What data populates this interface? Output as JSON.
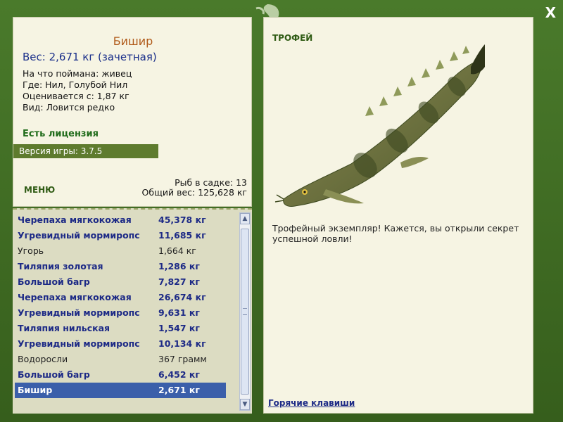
{
  "close_label": "X",
  "fish": {
    "name": "Бишир",
    "weight": "Вес: 2,671 кг (зачетная)",
    "caught_on": "На что поймана: живец",
    "location": "Где: Нил, Голубой Нил",
    "valued_from": "Оценивается с: 1,87 кг",
    "type": "Вид: Ловится редко"
  },
  "license": "Есть лицензия",
  "version": "Версия игры: 3.7.5",
  "menu_label": "МЕНЮ",
  "summary": {
    "fish_count": "Рыб в садке: 13",
    "total_weight": "Общий вес: 125,628 кг"
  },
  "catch_list": [
    {
      "name": "Черепаха мягкокожая",
      "weight": "45,378 кг",
      "style": "bold"
    },
    {
      "name": "Угревидный мормиропс",
      "weight": "11,685 кг",
      "style": "bold"
    },
    {
      "name": "Угорь",
      "weight": "1,664 кг",
      "style": "plain"
    },
    {
      "name": "Тиляпия золотая",
      "weight": "1,286 кг",
      "style": "bold"
    },
    {
      "name": "Большой багр",
      "weight": "7,827 кг",
      "style": "bold"
    },
    {
      "name": "Черепаха мягкокожая",
      "weight": "26,674 кг",
      "style": "bold"
    },
    {
      "name": "Угревидный мормиропс",
      "weight": "9,631 кг",
      "style": "bold"
    },
    {
      "name": "Тиляпия нильская",
      "weight": "1,547 кг",
      "style": "bold"
    },
    {
      "name": "Угревидный мормиропс",
      "weight": "10,134 кг",
      "style": "bold"
    },
    {
      "name": "Водоросли",
      "weight": "367 грамм",
      "style": "plain"
    },
    {
      "name": "Большой багр",
      "weight": "6,452 кг",
      "style": "bold"
    },
    {
      "name": "Бишир",
      "weight": "2,671 кг",
      "style": "selected"
    }
  ],
  "trophy_label": "ТРОФЕЙ",
  "trophy_text": "Трофейный экземпляр! Кажется, вы открыли секрет успешной ловли!",
  "hotkeys_label": "Горячие клавиши",
  "colors": {
    "frame": "#3f6a23",
    "panel": "#f6f4e3",
    "selected": "#3b5faa",
    "bold_text": "#1d2a86",
    "name": "#b05a1a"
  }
}
